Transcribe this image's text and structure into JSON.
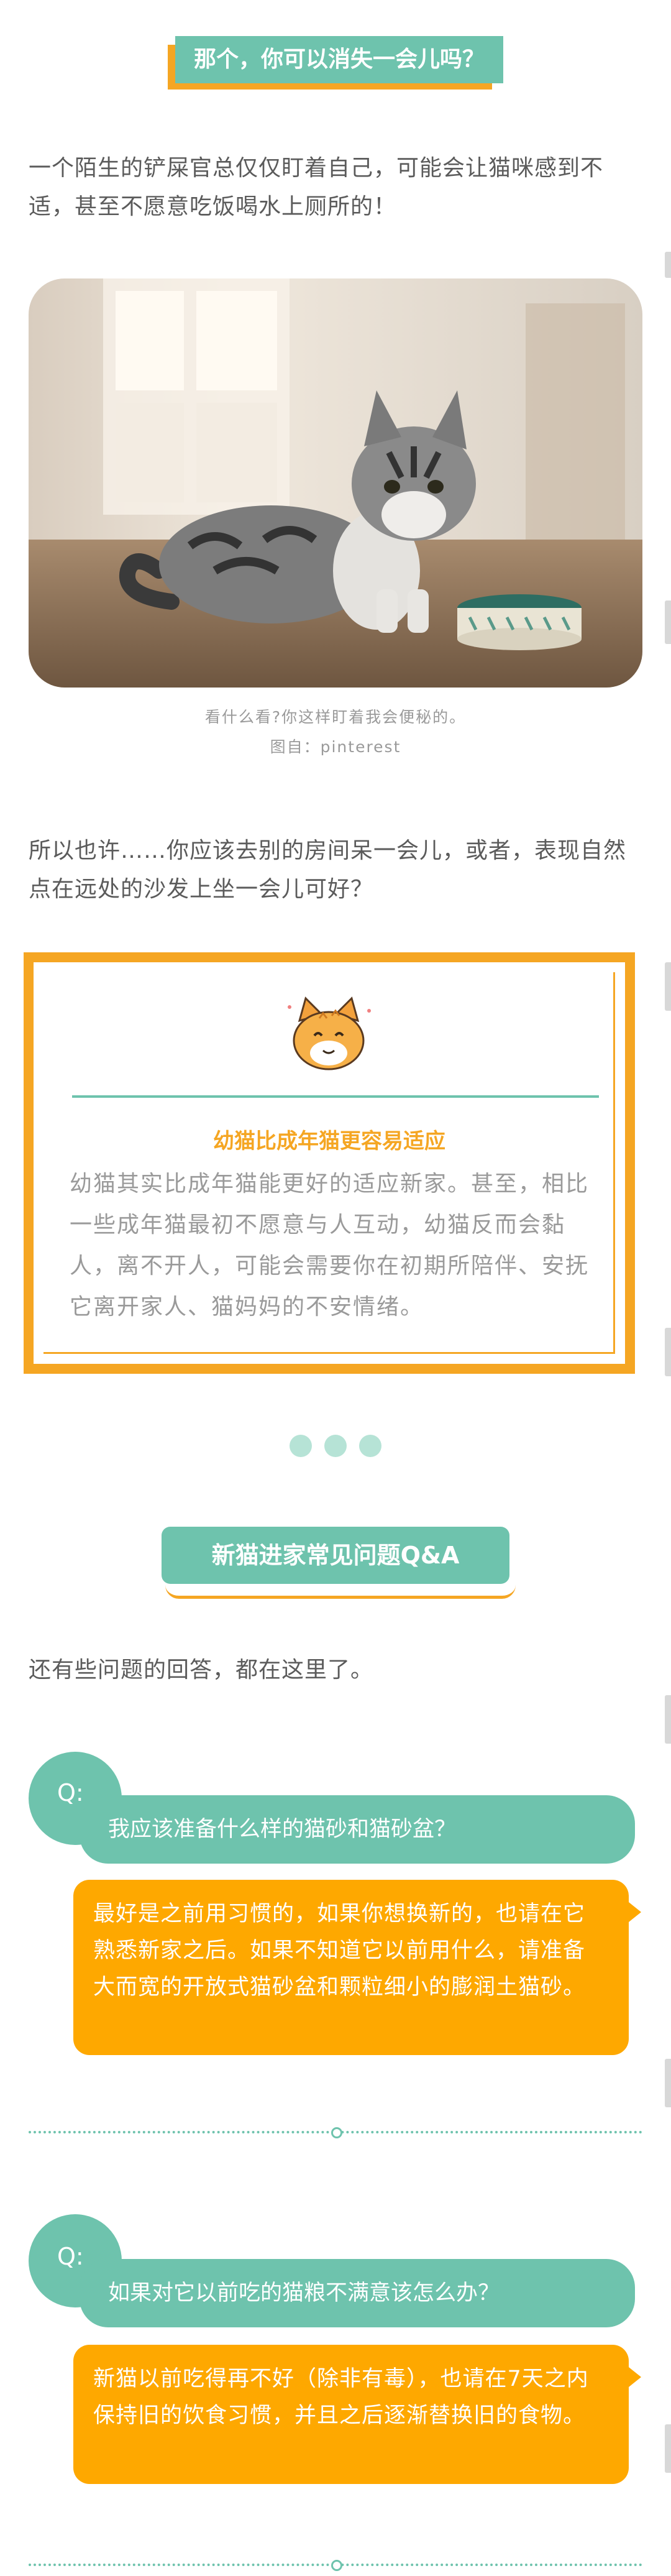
{
  "title_tag": "那个，你可以消失一会儿吗？",
  "intro_paragraph": "一个陌生的铲屎官总仅仅盯着自己，可能会让猫咪感到不适，甚至不愿意吃饭喝水上厕所的！",
  "photo": {
    "caption": "看什么看?你这样盯着我会便秘的。",
    "credit": "图自：pinterest"
  },
  "second_paragraph": "所以也许……你应该去别的房间呆一会儿，或者，表现自然点在远处的沙发上坐一会儿可好？",
  "tip_box": {
    "icon": "cat-face-icon",
    "heading": "幼猫比成年猫更容易适应",
    "body": "幼猫其实比成年猫能更好的适应新家。甚至，相比一些成年猫最初不愿意与人互动，幼猫反而会黏人，离不开人，可能会需要你在初期所陪伴、安抚它离开家人、猫妈妈的不安情绪。"
  },
  "section_header": "新猫进家常见问题Q&A",
  "section_intro": "还有些问题的回答，都在这里了。",
  "qa": [
    {
      "q_label": "Q:",
      "question": "我应该准备什么样的猫砂和猫砂盆？",
      "answer": "最好是之前用习惯的，如果你想换新的，也请在它熟悉新家之后。如果不知道它以前用什么，请准备大而宽的开放式猫砂盆和颗粒细小的膨润土猫砂。"
    },
    {
      "q_label": "Q:",
      "question": "如果对它以前吃的猫粮不满意该怎么办？",
      "answer": "新猫以前吃得再不好（除非有毒），也请在7天之内保持旧的饮食习惯，并且之后逐渐替换旧的食物。"
    }
  ],
  "colors": {
    "teal": "#6ec3ad",
    "orange": "#f5a623",
    "answer_orange": "#fea800"
  }
}
